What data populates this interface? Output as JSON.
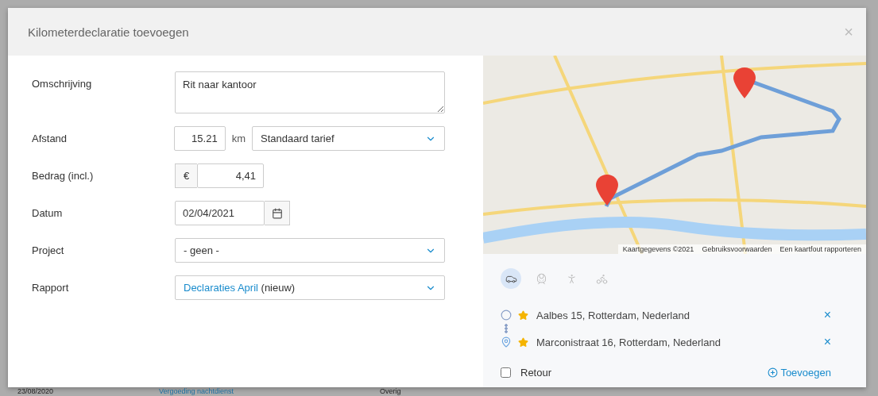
{
  "dialog": {
    "title": "Kilometerdeclaratie toevoegen",
    "close": "×"
  },
  "form": [
    {
      "kind": "textarea",
      "label": "Omschrijving",
      "value": "Rit naar kantoor"
    },
    {
      "kind": "distance",
      "label": "Afstand",
      "value": "15.21",
      "unit": "km",
      "rate": "Standaard tarief"
    },
    {
      "kind": "amount",
      "label": "Bedrag (incl.)",
      "currency": "€",
      "value": "4,41"
    },
    {
      "kind": "date",
      "label": "Datum",
      "value": "02/04/2021"
    },
    {
      "kind": "select",
      "label": "Project",
      "value": "- geen -"
    },
    {
      "kind": "report",
      "label": "Rapport",
      "link": "Declaraties April",
      "note": "(nieuw)"
    }
  ],
  "map": {
    "attribution": [
      "Kaartgegevens ©2021",
      "Gebruiksvoorwaarden",
      "Een kaartfout rapporteren"
    ]
  },
  "transport_modes": [
    {
      "kind": "car",
      "selected": true
    },
    {
      "kind": "train",
      "selected": false
    },
    {
      "kind": "walk",
      "selected": false
    },
    {
      "kind": "bike",
      "selected": false
    }
  ],
  "waypoints": [
    {
      "kind": "start",
      "address": "Aalbes 15, Rotterdam, Nederland",
      "remove": "×"
    },
    {
      "kind": "end",
      "address": "Marconistraat 16, Rotterdam, Nederland",
      "remove": "×"
    }
  ],
  "retour": {
    "label": "Retour",
    "checked": false
  },
  "add_button": "Toevoegen",
  "background_row": [
    "23/08/2020",
    "Vergoeding nachtdienst",
    "Overig"
  ]
}
